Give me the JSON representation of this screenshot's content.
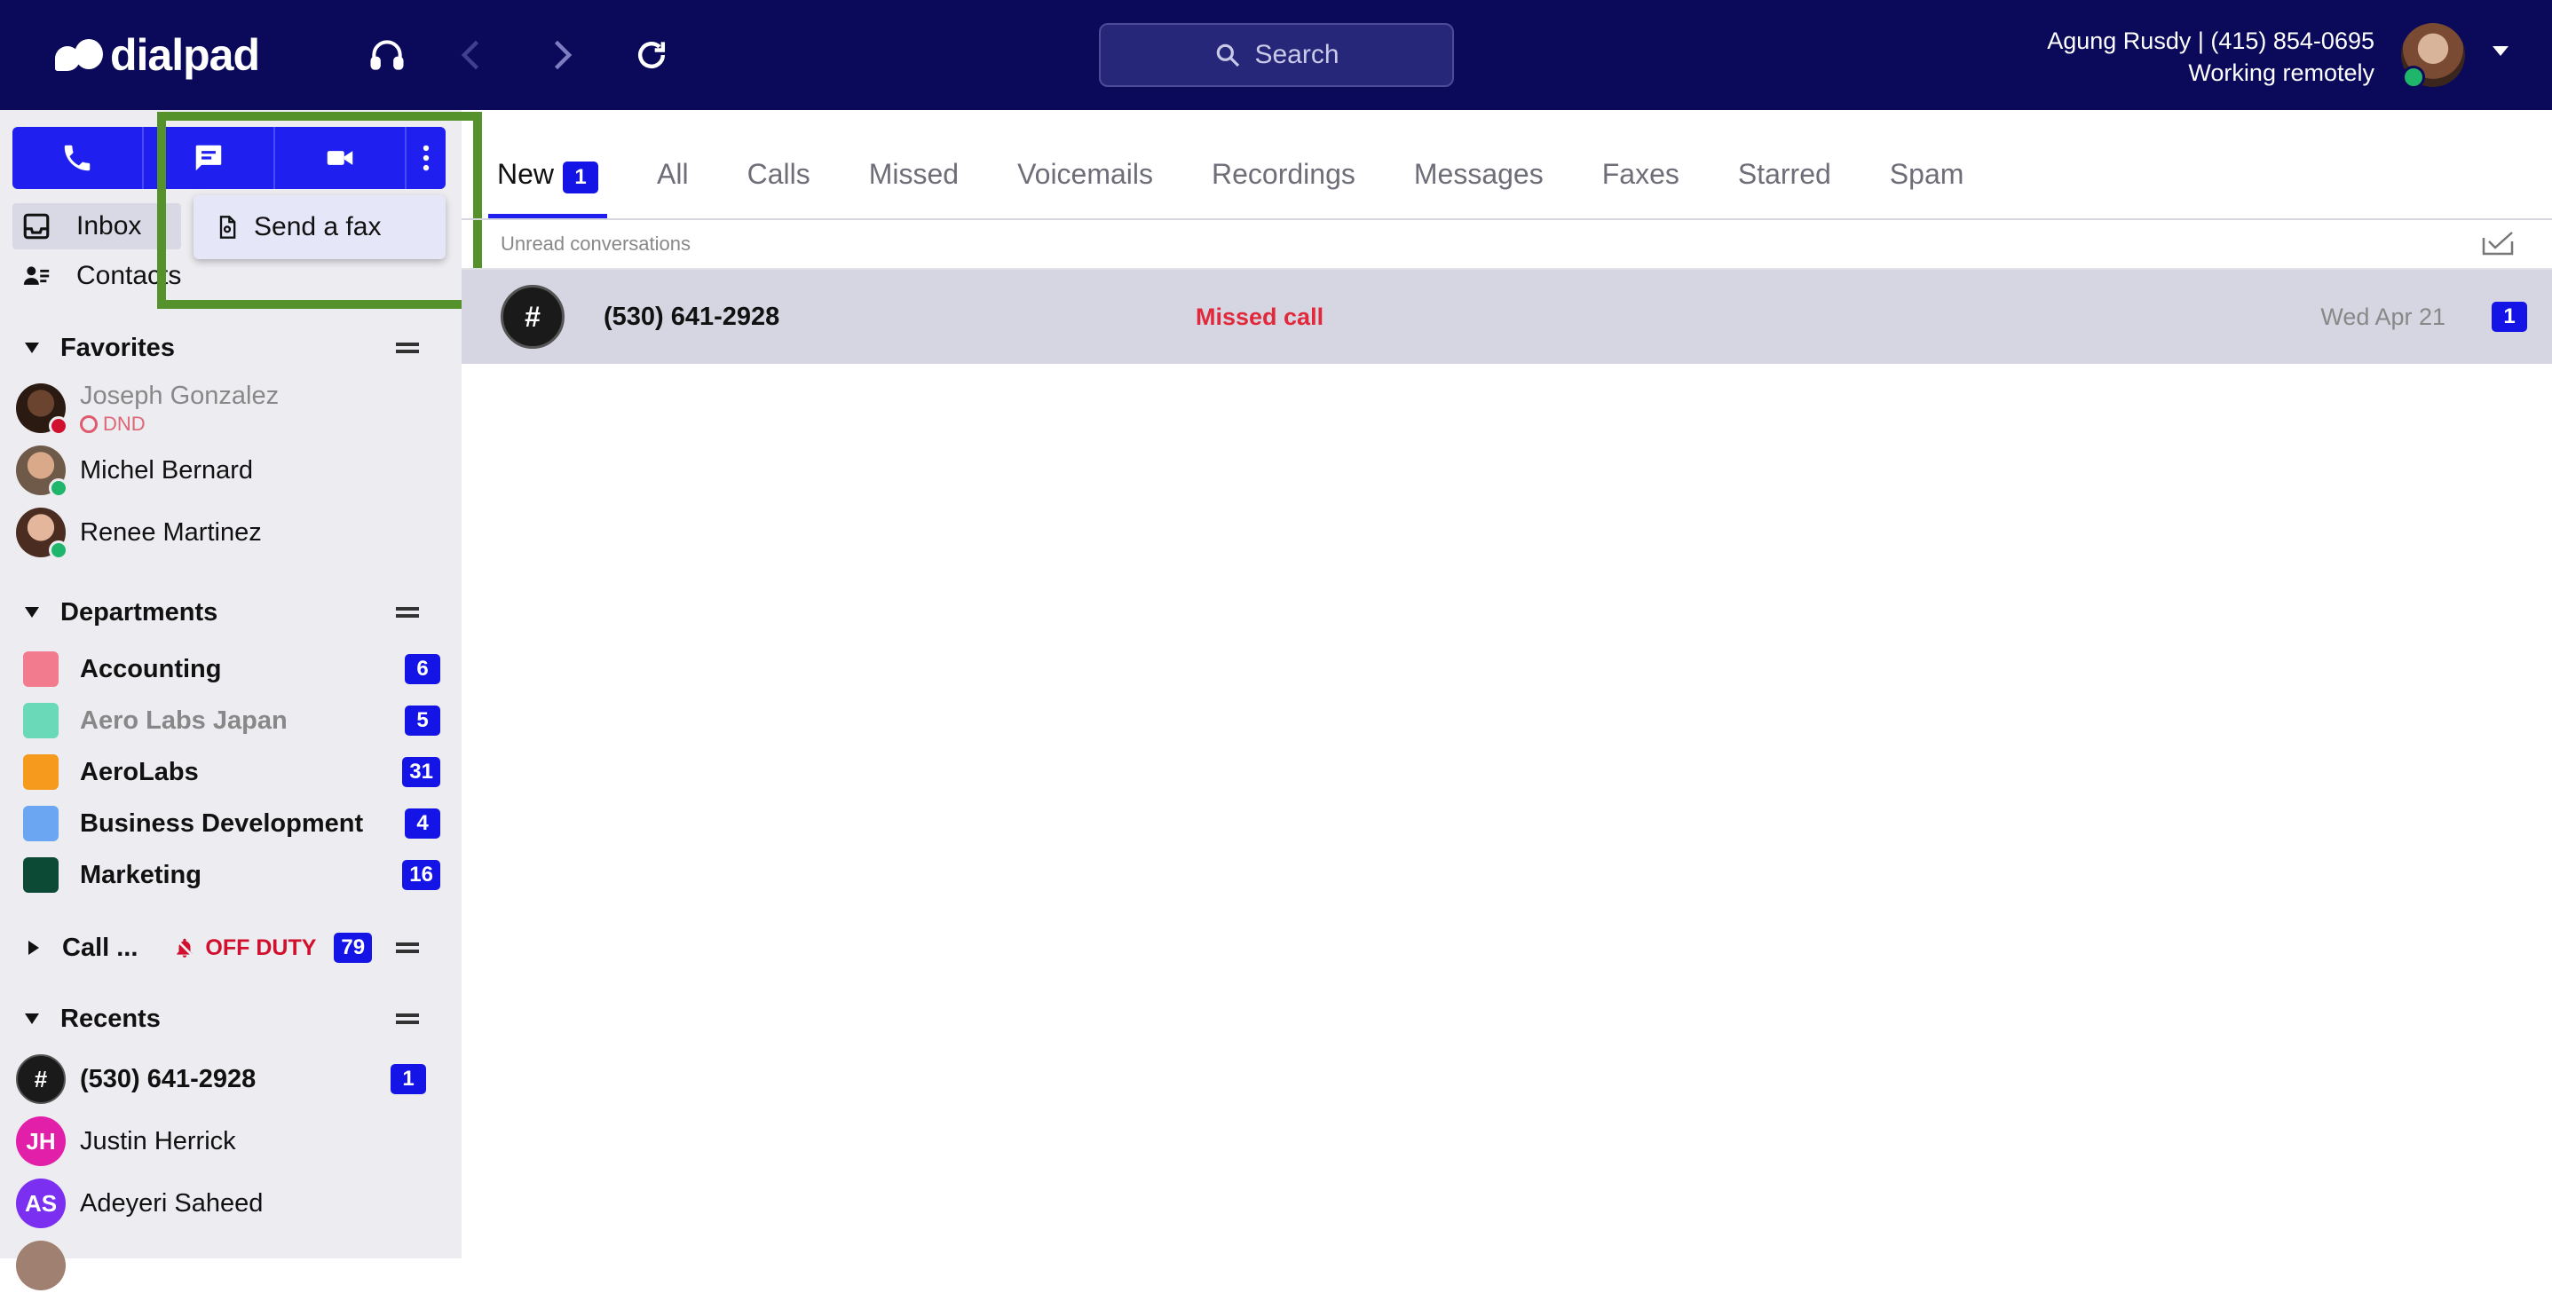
{
  "app": {
    "logo": "dialpad"
  },
  "search": {
    "label": "Search"
  },
  "user": {
    "line1": "Agung Rusdy | (415) 854-0695",
    "line2": "Working remotely"
  },
  "menu": {
    "send_fax": "Send a fax"
  },
  "nav": {
    "inbox": "Inbox",
    "contacts": "Contacts"
  },
  "favorites": {
    "title": "Favorites",
    "people": [
      {
        "name": "Joseph Gonzalez",
        "status": "DND"
      },
      {
        "name": "Michel Bernard"
      },
      {
        "name": "Renee Martinez"
      }
    ]
  },
  "departments": {
    "title": "Departments",
    "items": [
      {
        "name": "Accounting",
        "count": "6",
        "color": "#f27b8e"
      },
      {
        "name": "Aero Labs Japan",
        "count": "5",
        "color": "#6ad9b7"
      },
      {
        "name": "AeroLabs",
        "count": "31",
        "color": "#f59a1c"
      },
      {
        "name": "Business Development",
        "count": "4",
        "color": "#6aa6f2"
      },
      {
        "name": "Marketing",
        "count": "16",
        "color": "#0c4a35"
      }
    ]
  },
  "callcenter": {
    "title": "Call ...",
    "status": "OFF DUTY",
    "count": "79"
  },
  "recents": {
    "title": "Recents",
    "items": [
      {
        "initials": "#",
        "name": "(530) 641-2928",
        "count": "1"
      },
      {
        "initials": "JH",
        "name": "Justin Herrick"
      },
      {
        "initials": "AS",
        "name": "Adeyeri Saheed"
      }
    ]
  },
  "tabs": [
    {
      "label": "New",
      "count": "1"
    },
    {
      "label": "All"
    },
    {
      "label": "Calls"
    },
    {
      "label": "Missed"
    },
    {
      "label": "Voicemails"
    },
    {
      "label": "Recordings"
    },
    {
      "label": "Messages"
    },
    {
      "label": "Faxes"
    },
    {
      "label": "Starred"
    },
    {
      "label": "Spam"
    }
  ],
  "list": {
    "subheading": "Unread conversations",
    "rows": [
      {
        "icon": "#",
        "number": "(530) 641-2928",
        "status": "Missed call",
        "date": "Wed Apr 21",
        "count": "1"
      }
    ]
  }
}
